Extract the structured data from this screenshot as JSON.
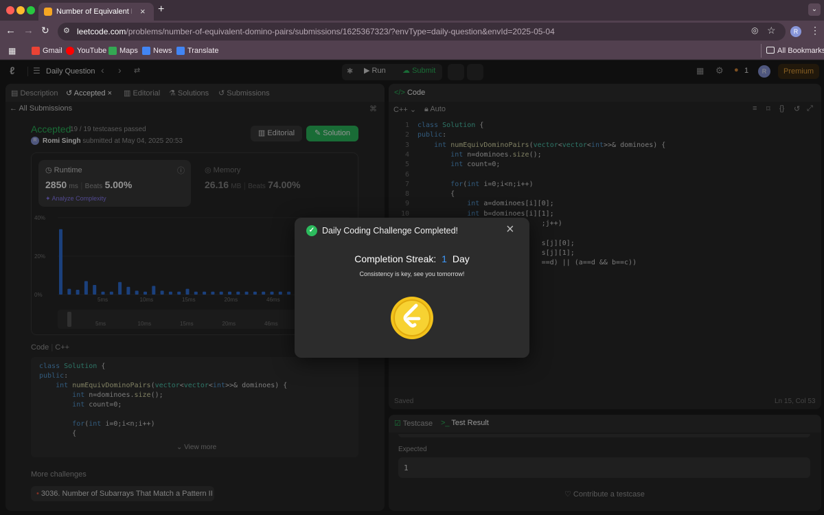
{
  "browser": {
    "tab_title": "Number of Equivalent Domino",
    "url_domain": "leetcode.com",
    "url_path": "/problems/number-of-equivalent-domino-pairs/submissions/1625367323/?envType=daily-question&envId=2025-05-04",
    "profile_initial": "R",
    "bookmarks": [
      "Gmail",
      "YouTube",
      "Maps",
      "News",
      "Translate"
    ],
    "all_bookmarks": "All Bookmarks"
  },
  "lc_header": {
    "daily_question": "Daily Question",
    "run": "Run",
    "submit": "Submit",
    "streak_count": "1",
    "avatar_initial": "R",
    "premium": "Premium"
  },
  "left_tabs": [
    "Description",
    "Accepted",
    "Editorial",
    "Solutions",
    "Submissions"
  ],
  "submission": {
    "all_submissions": "All Submissions",
    "status": "Accepted",
    "testcases": "19 / 19 testcases passed",
    "user_initial": "R",
    "user": "Romi Singh",
    "submitted_at": "submitted at May 04, 2025 20:53",
    "editorial_btn": "Editorial",
    "solution_btn": "Solution",
    "runtime_label": "Runtime",
    "runtime_value": "2850",
    "runtime_unit": "ms",
    "runtime_beats_label": "Beats",
    "runtime_beats": "5.00%",
    "analyze": "Analyze Complexity",
    "memory_label": "Memory",
    "memory_value": "26.16",
    "memory_unit": "MB",
    "memory_beats_label": "Beats",
    "memory_beats": "74.00%",
    "code_label": "Code",
    "code_lang": "C++",
    "view_more": "View more",
    "more_challenges": "More challenges",
    "challenge_1": "3036. Number of Subarrays That Match a Pattern II"
  },
  "chart_data": {
    "type": "bar",
    "y_ticks": [
      "40%",
      "20%",
      "0%"
    ],
    "x_ticks": [
      "5ms",
      "10ms",
      "15ms",
      "20ms",
      "46ms"
    ],
    "mini_x_ticks": [
      "5ms",
      "10ms",
      "15ms",
      "20ms",
      "46ms"
    ],
    "ylim": [
      0,
      40
    ],
    "values": [
      34,
      3,
      2.5,
      7,
      5,
      1.5,
      1.5,
      6.5,
      4,
      2,
      1.5,
      4.5,
      2,
      1.5,
      1.5,
      3,
      1.5,
      1.5,
      1.5,
      1.5,
      1.5,
      1.5,
      1.5,
      1.5,
      1.5,
      1.5,
      1.5,
      1.5
    ]
  },
  "code_panel": {
    "title": "Code",
    "lang": "C++",
    "mode": "Auto",
    "saved": "Saved",
    "cursor": "Ln 15, Col 53"
  },
  "editor_lines": [
    {
      "n": "1",
      "html": "<span class='kw'>class</span> <span class='cls'>Solution</span> {"
    },
    {
      "n": "2",
      "html": "<span class='kw'>public</span>:"
    },
    {
      "n": "3",
      "html": "    <span class='kw'>int</span> <span class='fn'>numEquivDominoPairs</span>(<span class='cls'>vector</span>&lt;<span class='cls'>vector</span>&lt;<span class='kw'>int</span>&gt;&gt;&amp; dominoes) {"
    },
    {
      "n": "4",
      "html": "        <span class='kw'>int</span> n=dominoes.<span class='fn'>size</span>();"
    },
    {
      "n": "5",
      "html": "        <span class='kw'>int</span> count=0;"
    },
    {
      "n": "6",
      "html": ""
    },
    {
      "n": "7",
      "html": "        <span class='kw'>for</span>(<span class='kw'>int</span> i=0;i&lt;n;i++)"
    },
    {
      "n": "8",
      "html": "        {"
    },
    {
      "n": "9",
      "html": "            <span class='kw'>int</span> a=dominoes[i][0];"
    },
    {
      "n": "10",
      "html": "            <span class='kw'>int</span> b=dominoes[i][1];"
    },
    {
      "n": "11",
      "html": "                              ;j++)"
    },
    {
      "n": "12",
      "html": ""
    },
    {
      "n": "13",
      "html": "                              s[j][0];"
    },
    {
      "n": "14",
      "html": "                              s[j][1];"
    },
    {
      "n": "15",
      "html": "                              ==d) || (a==d &amp;&amp; b==c))"
    }
  ],
  "left_code_lines": [
    "<span class='kw'>class</span> <span class='cls'>Solution</span> {",
    "<span class='kw'>public</span>:",
    "    <span class='kw'>int</span> <span class='fn'>numEquivDominoPairs</span>(<span class='cls'>vector</span>&lt;<span class='cls'>vector</span>&lt;<span class='kw'>int</span>&gt;&gt;&amp; dominoes) {",
    "        <span class='kw'>int</span> n=dominoes.<span class='fn'>size</span>();",
    "        <span class='kw'>int</span> count=0;",
    "",
    "        <span class='kw'>for</span>(<span class='kw'>int</span> i=0;i&lt;n;i++)",
    "        {"
  ],
  "testcase": {
    "tab_testcase": "Testcase",
    "tab_result": "Test Result",
    "expected_label": "Expected",
    "expected_value": "1",
    "contribute": "Contribute a testcase"
  },
  "modal": {
    "title": "Daily Coding Challenge Completed!",
    "streak_label": "Completion Streak:",
    "streak_number": "1",
    "streak_unit": "Day",
    "subtitle": "Consistency is key, see you tomorrow!"
  }
}
